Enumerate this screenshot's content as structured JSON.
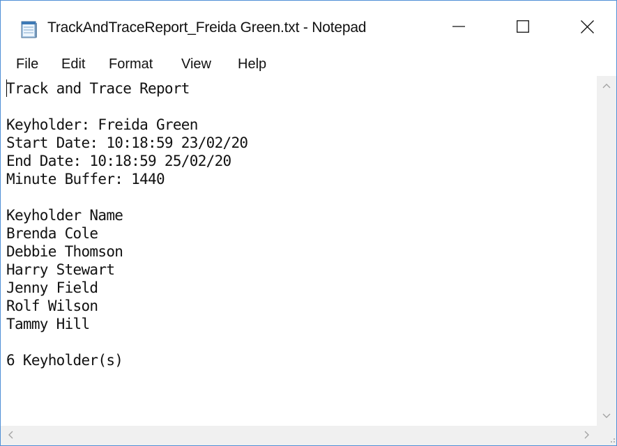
{
  "window": {
    "title": "TrackAndTraceReport_Freida Green.txt - Notepad",
    "icon": "notepad-icon",
    "controls": [
      "minimize-icon",
      "maximize-icon",
      "close-icon"
    ]
  },
  "menu": {
    "file": "File",
    "edit": "Edit",
    "format": "Format",
    "view": "View",
    "help": "Help"
  },
  "document": {
    "lines": [
      "Track and Trace Report",
      "",
      "Keyholder: Freida Green",
      "Start Date: 10:18:59 23/02/20",
      "End Date: 10:18:59 25/02/20",
      "Minute Buffer: 1440",
      "",
      "Keyholder Name",
      "Brenda Cole",
      "Debbie Thomson",
      "Harry Stewart",
      "Jenny Field",
      "Rolf Wilson",
      "Tammy Hill",
      "",
      "6 Keyholder(s)"
    ]
  },
  "colors": {
    "window_border": "#4f8fd6",
    "scrollbar_track": "#f0f0f0",
    "scrollbar_arrow": "#a3a3a3",
    "text": "#111111"
  }
}
